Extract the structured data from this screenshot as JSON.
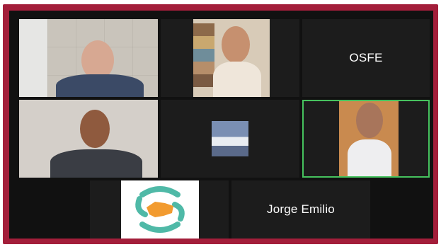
{
  "meeting": {
    "participants": [
      {
        "id": "p1",
        "type": "video"
      },
      {
        "id": "p2",
        "type": "video"
      },
      {
        "id": "p3",
        "type": "name",
        "name": "OSFE"
      },
      {
        "id": "p4",
        "type": "video"
      },
      {
        "id": "p5",
        "type": "video"
      },
      {
        "id": "p6",
        "type": "video",
        "active_speaker": true
      },
      {
        "id": "p7",
        "type": "logo"
      },
      {
        "id": "p8",
        "type": "name",
        "name": "Jorge Emilio"
      }
    ]
  },
  "colors": {
    "frame": "#a31e3a",
    "active_speaker_border": "#46c25e",
    "logo_teal": "#4fb9a7",
    "logo_orange": "#f29b30"
  }
}
